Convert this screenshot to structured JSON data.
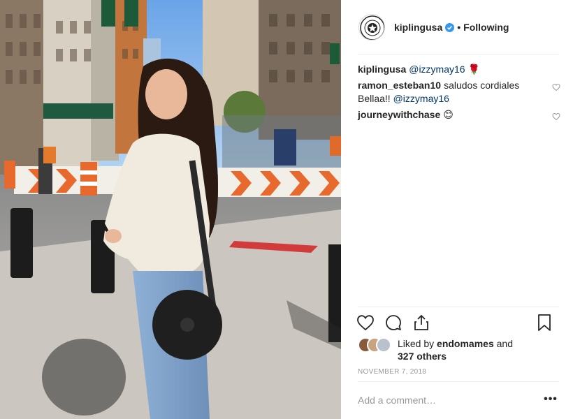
{
  "post": {
    "account": "kiplingusa",
    "follow_state": "Following",
    "separator": "•",
    "avatar_text_top": "KIPLING",
    "avatar_text_bottom": "KIPLING"
  },
  "comments": [
    {
      "user": "kiplingusa",
      "text": "@izzymay16",
      "emoji": "🌹",
      "has_like": false
    },
    {
      "user": "ramon_esteban10",
      "text_pre": "saludos cordiales Bellaa!! ",
      "mention": "@izzymay16",
      "has_like": true
    },
    {
      "user": "journeywithchase",
      "emoji": "😊",
      "has_like": true
    }
  ],
  "likes": {
    "prefix": "Liked by ",
    "user": "endomames",
    "joiner": " and",
    "others": "327 others"
  },
  "date": "NOVEMBER 7, 2018",
  "comment_box": {
    "placeholder": "Add a comment…"
  },
  "more_label": "•••",
  "icons": {
    "like": "heart-icon",
    "comment": "speech-bubble-icon",
    "share": "share-upload-icon",
    "save": "bookmark-icon",
    "verified": "verified-badge-icon"
  },
  "colors": {
    "text": "#262626",
    "muted": "#999999",
    "divider": "#efefef",
    "verified": "#3897f0",
    "mention": "#003569"
  }
}
